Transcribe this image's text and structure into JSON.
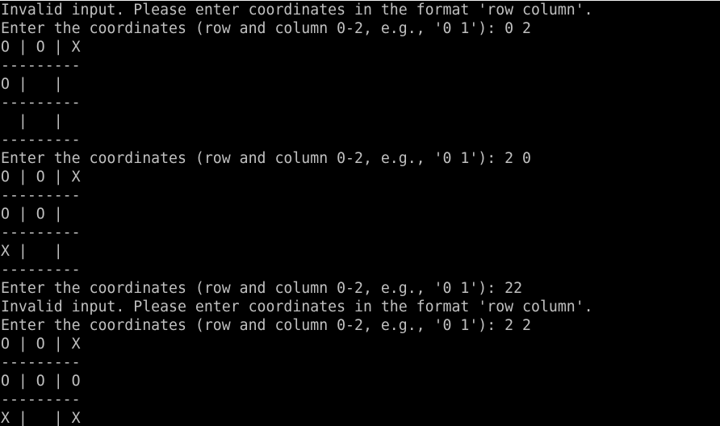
{
  "colors": {
    "background": "#000000",
    "text": "#c0c0c0"
  },
  "terminal": {
    "lines": [
      {
        "text": "Invalid input. Please enter coordinates in the format 'row column'.",
        "kind": "error-message"
      },
      {
        "text": "Enter the coordinates (row and column 0-2, e.g., '0 1'): 0 2",
        "kind": "prompt"
      },
      {
        "text": "O | O | X",
        "kind": "board-row"
      },
      {
        "text": "---------",
        "kind": "board-separator"
      },
      {
        "text": "O |   |",
        "kind": "board-row"
      },
      {
        "text": "---------",
        "kind": "board-separator"
      },
      {
        "text": "  |   |",
        "kind": "board-row"
      },
      {
        "text": "---------",
        "kind": "board-separator"
      },
      {
        "text": "Enter the coordinates (row and column 0-2, e.g., '0 1'): 2 0",
        "kind": "prompt"
      },
      {
        "text": "O | O | X",
        "kind": "board-row"
      },
      {
        "text": "---------",
        "kind": "board-separator"
      },
      {
        "text": "O | O |",
        "kind": "board-row"
      },
      {
        "text": "---------",
        "kind": "board-separator"
      },
      {
        "text": "X |   |",
        "kind": "board-row"
      },
      {
        "text": "---------",
        "kind": "board-separator"
      },
      {
        "text": "Enter the coordinates (row and column 0-2, e.g., '0 1'): 22",
        "kind": "prompt"
      },
      {
        "text": "Invalid input. Please enter coordinates in the format 'row column'.",
        "kind": "error-message"
      },
      {
        "text": "Enter the coordinates (row and column 0-2, e.g., '0 1'): 2 2",
        "kind": "prompt"
      },
      {
        "text": "O | O | X",
        "kind": "board-row"
      },
      {
        "text": "---------",
        "kind": "board-separator"
      },
      {
        "text": "O | O | O",
        "kind": "board-row"
      },
      {
        "text": "---------",
        "kind": "board-separator"
      },
      {
        "text": "X |   | X",
        "kind": "board-row"
      }
    ]
  }
}
